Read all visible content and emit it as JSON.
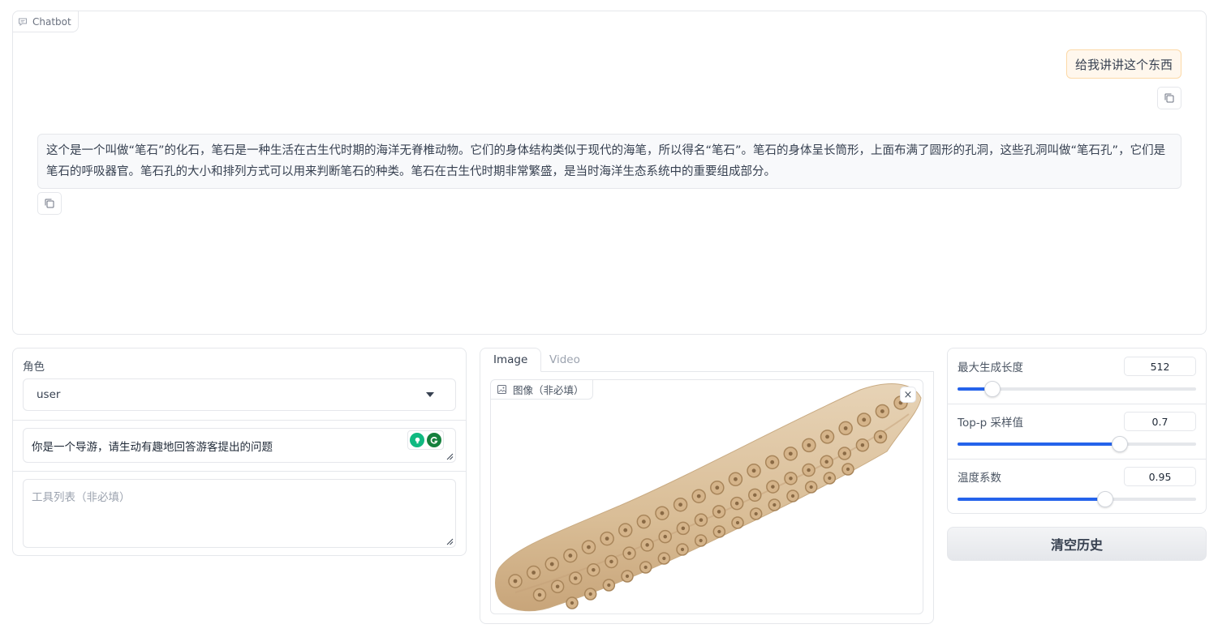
{
  "chatbot": {
    "label": "Chatbot",
    "messages": [
      {
        "role": "user",
        "text": "给我讲讲这个东西"
      },
      {
        "role": "assistant",
        "text": "这个是一个叫做“笔石”的化石，笔石是一种生活在古生代时期的海洋无脊椎动物。它们的身体结构类似于现代的海笔，所以得名“笔石”。笔石的身体呈长筒形，上面布满了圆形的孔洞，这些孔洞叫做“笔石孔”，它们是笔石的呼吸器官。笔石孔的大小和排列方式可以用来判断笔石的种类。笔石在古生代时期非常繁盛，是当时海洋生态系统中的重要组成部分。"
      }
    ],
    "copy_icon": "copy-icon"
  },
  "left": {
    "role_label": "角色",
    "role_value": "user",
    "system_prompt_value": "你是一个导游，请生动有趣地回答游客提出的问题",
    "tools_placeholder": "工具列表（非必填）"
  },
  "media": {
    "tabs": [
      {
        "label": "Image",
        "active": true
      },
      {
        "label": "Video",
        "active": false
      }
    ],
    "image_label": "图像（非必填）",
    "close_icon": "close-icon"
  },
  "params": {
    "max_length": {
      "label": "最大生成长度",
      "value": "512",
      "fraction": 0.147
    },
    "top_p": {
      "label": "Top-p 采样值",
      "value": "0.7",
      "fraction": 0.68
    },
    "temperature": {
      "label": "温度系数",
      "value": "0.95",
      "fraction": 0.62
    }
  },
  "clear_button": "清空历史",
  "colors": {
    "accent": "#2563eb",
    "user_bubble": "#fff7ed",
    "bot_bubble": "#f8f9fb"
  }
}
